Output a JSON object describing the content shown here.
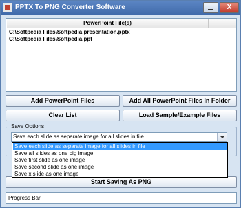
{
  "window": {
    "title": "PPTX To PNG Converter Software",
    "close_glyph": "X"
  },
  "file_list": {
    "header": "PowerPoint File(s)",
    "rows": [
      "C:\\Softpedia Files\\Softpedia presentation.pptx",
      "C:\\Softpedia Files\\Softpedia.ppt"
    ]
  },
  "buttons": {
    "add_files": "Add PowerPoint Files",
    "add_folder": "Add All PowerPoint Files In Folder",
    "clear_list": "Clear List",
    "load_sample": "Load Sample/Example Files",
    "start": "Start Saving As PNG"
  },
  "save_options": {
    "label": "Save Options",
    "selected": "Save each slide as separate image for all slides in file",
    "options": [
      "Save each slide as separate image for all slides in file",
      "Save all slides as one big image",
      "Save first slide as one image",
      "Save second slide as one image",
      "Save x slide as one image"
    ]
  },
  "progress_label": "Progress Bar"
}
